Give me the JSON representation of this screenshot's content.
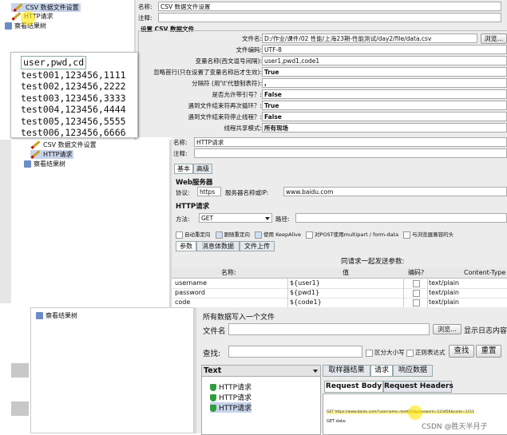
{
  "top_tree": {
    "items": [
      {
        "label": "CSV 数据文件设置"
      },
      {
        "label": "HTTP请求"
      },
      {
        "label": "察看结果树"
      }
    ]
  },
  "csv_config": {
    "name_label": "名称:",
    "name_value": "CSV 数据文件设置",
    "comment_label": "注释:",
    "section_title": "设置 CSV 数据文件",
    "rows": [
      {
        "label": "文件名:",
        "value": "D:/作业/课件/02 性能/上海23期-性能测试/day2/file/data.csv"
      },
      {
        "label": "文件编码:",
        "value": "UTF-8"
      },
      {
        "label": "变量名称(西文逗号间隔):",
        "value": "user1,pwd1,code1"
      },
      {
        "label": "忽略首行(只在设置了变量名称后才生效):",
        "value": "True"
      },
      {
        "label": "分隔符 (用'\\t'代替制表符):",
        "value": ","
      },
      {
        "label": "是否允许带引号？:",
        "value": "False"
      },
      {
        "label": "遇到文件结束符再次循环？:",
        "value": "True"
      },
      {
        "label": "遇到文件结束符停止线程？:",
        "value": "False"
      },
      {
        "label": "线程共享模式:",
        "value": "所有现场"
      }
    ],
    "browse_label": "浏览..."
  },
  "csv_popup": {
    "lines": [
      "user,pwd,cd",
      "test001,123456,1111",
      "test002,123456,2222",
      "test003,123456,3333",
      "test004,123456,4444",
      "test005,123456,5555",
      "test006,123456,6666"
    ]
  },
  "mid_tree": {
    "items": [
      {
        "label": "CSV 数据文件设置"
      },
      {
        "label": "HTTP请求"
      },
      {
        "label": "察看结果树"
      }
    ]
  },
  "http_request": {
    "name_label": "名称:",
    "name_value": "HTTP请求",
    "comment_label": "注释:",
    "tabs": [
      "基本",
      "高级"
    ],
    "web_server_title": "Web服务器",
    "protocol_label": "协议:",
    "protocol_value": "https",
    "server_label": "服务器名称或IP:",
    "server_value": "www.baidu.com",
    "http_title": "HTTP请求",
    "method_label": "方法:",
    "method_value": "GET",
    "path_label": "路径:",
    "options": [
      {
        "label": "自动重定向",
        "checked": false
      },
      {
        "label": "跟随重定向",
        "checked": true
      },
      {
        "label": "使用 KeepAlive",
        "checked": true
      },
      {
        "label": "对POST使用multipart / form-data",
        "checked": false
      },
      {
        "label": "与浏览器兼容的头",
        "checked": false
      }
    ],
    "param_tabs": [
      "参数",
      "消息体数据",
      "文件上传"
    ],
    "send_together": "同请求一起发送参数:",
    "columns": [
      "名称:",
      "值",
      "编码?",
      "Content-Type"
    ],
    "params": [
      {
        "name": "username",
        "value": "${user1}",
        "type": "text/plain"
      },
      {
        "name": "password",
        "value": "${pwd1}",
        "type": "text/plain"
      },
      {
        "name": "code",
        "value": "${code1}",
        "type": "text/plain"
      }
    ]
  },
  "results_tree": {
    "left_item": "察看结果树",
    "write_all": "所有数据写入一个文件",
    "filename_label": "文件名",
    "browse_label": "浏览...",
    "show_log": "显示日志内容",
    "search_label": "查找:",
    "case_label": "区分大小写",
    "regex_label": "正则表达式",
    "find_button": "查找",
    "reset_button": "重置",
    "list_header": "Text",
    "samples": [
      "HTTP请求",
      "HTTP请求",
      "HTTP请求"
    ],
    "result_tabs": [
      "取样器结果",
      "请求",
      "响应数据"
    ],
    "sub_tabs": [
      "Request Body",
      "Request Headers"
    ],
    "request_line": "GET https://www.baidu.com/?username=test001&password=123456&code=1111",
    "get_data": "GET data:"
  },
  "watermark": "CSDN @胜天半月子"
}
